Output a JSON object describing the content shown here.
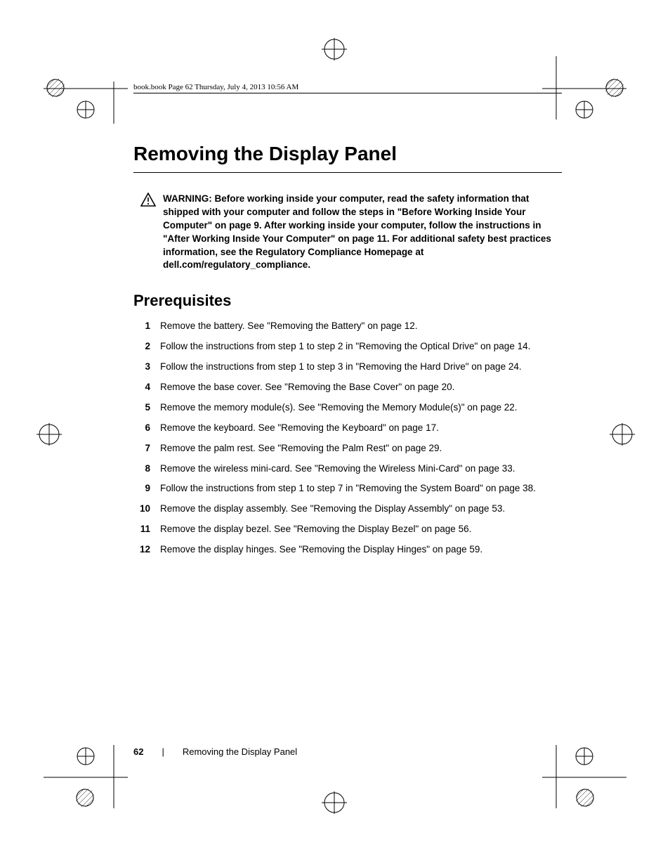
{
  "header_line": "book.book  Page 62  Thursday, July 4, 2013  10:56 AM",
  "title": "Removing the Display Panel",
  "warning": {
    "label": "WARNING:",
    "text": "Before working inside your computer, read the safety information that shipped with your computer and follow the steps in \"Before Working Inside Your Computer\" on page 9. After working inside your computer, follow the instructions in \"After Working Inside Your Computer\" on page 11. For additional safety best practices information, see the Regulatory Compliance Homepage at dell.com/regulatory_compliance."
  },
  "section_heading": "Prerequisites",
  "steps": [
    "Remove the battery. See \"Removing the Battery\" on page 12.",
    "Follow the instructions from step 1 to step 2 in \"Removing the Optical Drive\" on page 14.",
    "Follow the instructions from step 1 to step 3 in \"Removing the Hard Drive\" on page 24.",
    "Remove the base cover. See \"Removing the Base Cover\" on page 20.",
    "Remove the memory module(s). See \"Removing the Memory Module(s)\" on page 22.",
    "Remove the keyboard. See \"Removing the Keyboard\" on page 17.",
    "Remove the palm rest. See \"Removing the Palm Rest\" on page 29.",
    "Remove the wireless mini-card. See \"Removing the Wireless Mini-Card\" on page 33.",
    "Follow the instructions from step 1 to step 7 in \"Removing the System Board\" on page 38.",
    "Remove the display assembly. See \"Removing the Display Assembly\" on page 53.",
    "Remove the display bezel. See \"Removing the Display Bezel\" on page 56.",
    "Remove the display hinges. See \"Removing the Display Hinges\" on page 59."
  ],
  "footer": {
    "page_number": "62",
    "separator": "|",
    "label": "Removing the Display Panel"
  }
}
